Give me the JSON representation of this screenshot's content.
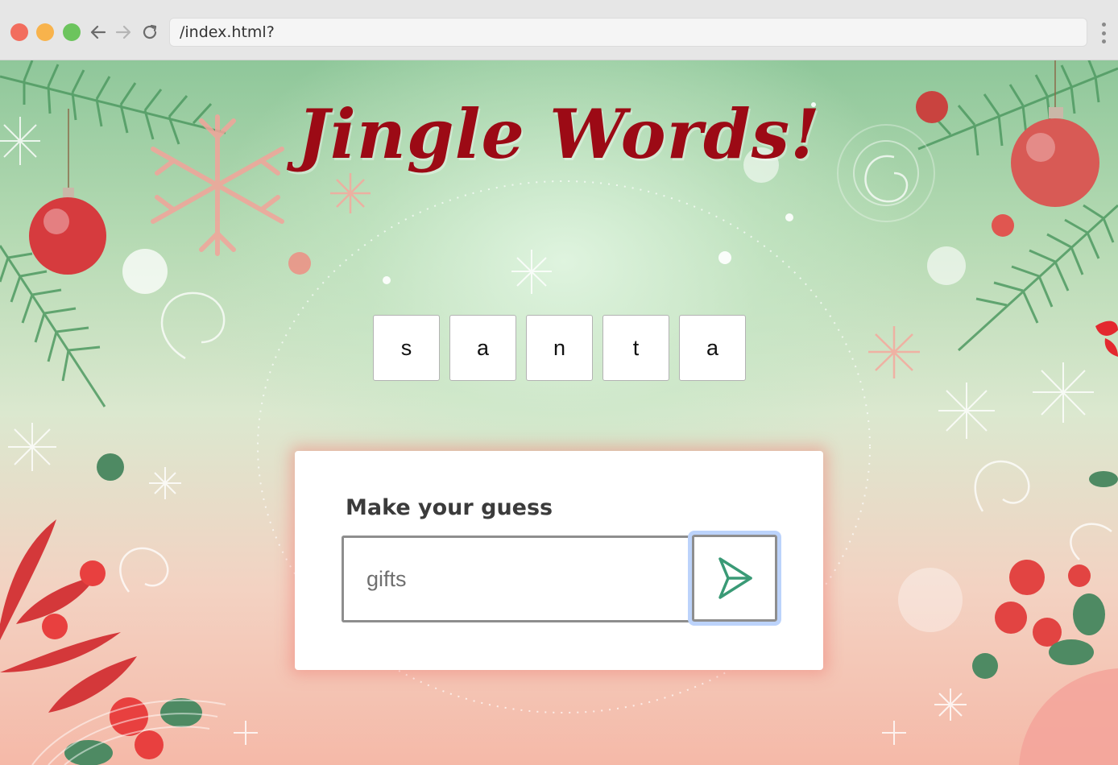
{
  "browser": {
    "url": "/index.html?"
  },
  "game": {
    "title": "Jingle Words!",
    "letters": [
      "s",
      "a",
      "n",
      "t",
      "a"
    ],
    "guess_label": "Make your guess",
    "guess_placeholder": "gifts",
    "guess_value": ""
  },
  "icons": {
    "back": "arrow-left-icon",
    "forward": "arrow-right-icon",
    "reload": "reload-icon",
    "menu": "vertical-dots-icon",
    "submit": "send-icon"
  },
  "colors": {
    "title": "#9c0a15",
    "submit_icon": "#3a9a76",
    "focus_ring": "#bcd3fb"
  }
}
